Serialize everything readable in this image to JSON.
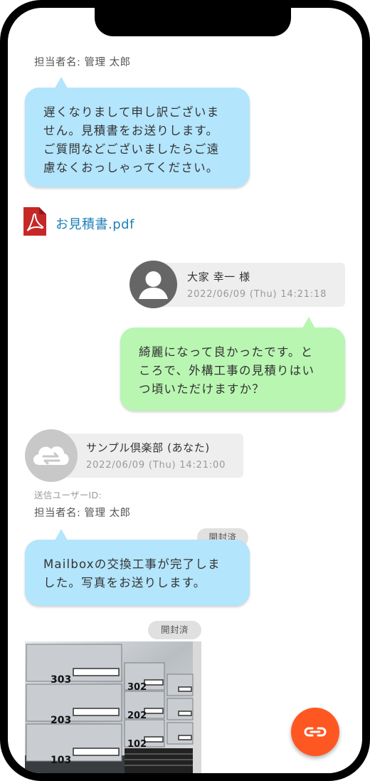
{
  "messages": {
    "staff_name_top": "担当者名: 管理 太郎",
    "bubble_top": [
      "遅くなりまして申し訳ございま",
      "せん。見積書をお送りします。",
      "ご質問などございましたらご遠",
      "慮なくおっしゃってください。"
    ],
    "attachment_name": "お見積書.pdf",
    "customer": {
      "name": "大家 幸一 様",
      "timestamp": "2022/06/09 (Thu) 14:21:18",
      "bubble": [
        "綺麗になって良かったです。と",
        "ころで、外構工事の見積りはい",
        "つ頃いただけますか？"
      ]
    },
    "company": {
      "name": "サンプル倶楽部 (あなた)",
      "timestamp": "2022/06/09 (Thu) 14:21:00",
      "sender_user_id_label": "送信ユーザーID:",
      "staff_name": "担当者名: 管理 太郎",
      "read_badge": "開封済",
      "bubble": [
        "Mailboxの交換工事が完了しま",
        "した。写真をお送りします。"
      ],
      "photo_read_badge": "開封済"
    },
    "photo_box_numbers": [
      "303",
      "302",
      "203",
      "202",
      "103",
      "102"
    ]
  },
  "colors": {
    "staff_bubble": "#b3e5fc",
    "customer_bubble": "#b9f6b2",
    "fab": "#ff5722",
    "link": "#1e7fb8",
    "pdf_icon": "#c62828"
  },
  "icons": {
    "pdf": "pdf-file-icon",
    "fab": "link-icon",
    "customer_avatar": "person-avatar-icon",
    "company_avatar": "cloud-sync-icon"
  }
}
